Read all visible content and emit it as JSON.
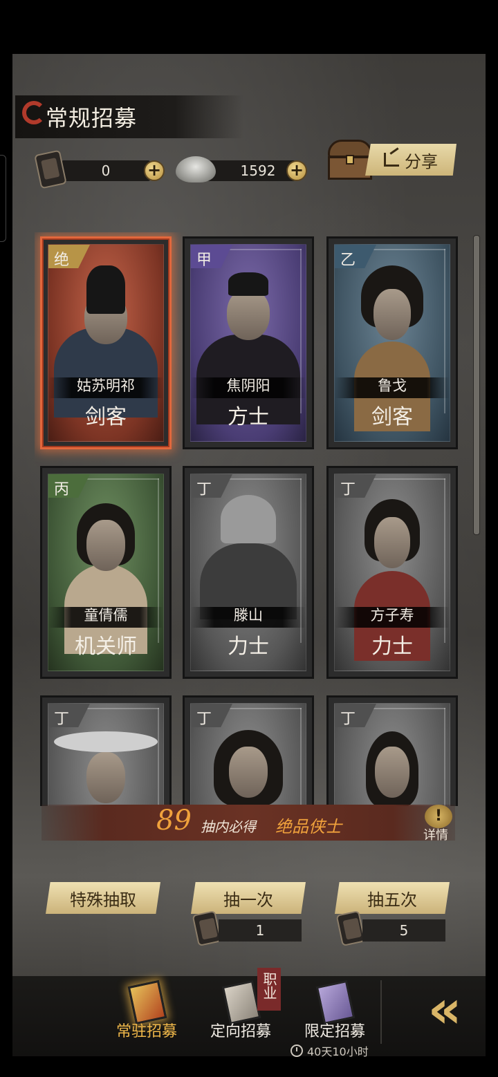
{
  "header": {
    "title": "常规招募",
    "share_label": "分享"
  },
  "currency": {
    "token_amount": "0",
    "silver_amount": "1592"
  },
  "cards": [
    {
      "rank": "绝",
      "name": "姑苏明祁",
      "class": "剑客",
      "tier": "jue"
    },
    {
      "rank": "甲",
      "name": "焦阴阳",
      "class": "方士",
      "tier": "jia"
    },
    {
      "rank": "乙",
      "name": "鲁戈",
      "class": "剑客",
      "tier": "yi"
    },
    {
      "rank": "丙",
      "name": "童倩儒",
      "class": "机关师",
      "tier": "bing"
    },
    {
      "rank": "丁",
      "name": "滕山",
      "class": "力士",
      "tier": "ding"
    },
    {
      "rank": "丁",
      "name": "方子寿",
      "class": "力士",
      "tier": "ding"
    },
    {
      "rank": "丁",
      "name": "",
      "class": "",
      "tier": "ding"
    },
    {
      "rank": "丁",
      "name": "",
      "class": "",
      "tier": "ding"
    },
    {
      "rank": "丁",
      "name": "",
      "class": "",
      "tier": "ding"
    }
  ],
  "banner": {
    "count": "89",
    "text1": "抽内必得",
    "text2": "绝品侠士",
    "detail_label": "详情"
  },
  "draw_buttons": {
    "special": "特殊抽取",
    "once": "抽一次",
    "five": "抽五次",
    "once_cost": "1",
    "five_cost": "5"
  },
  "tabs": {
    "regular": "常驻招募",
    "targeted": "定向招募",
    "targeted_tag": "职业",
    "limited": "限定招募",
    "limited_timer": "40天10小时"
  },
  "colors": {
    "accent_gold": "#e8d9a9",
    "highlight_orange": "#f0a23c",
    "tab_active": "#f0b84a"
  }
}
